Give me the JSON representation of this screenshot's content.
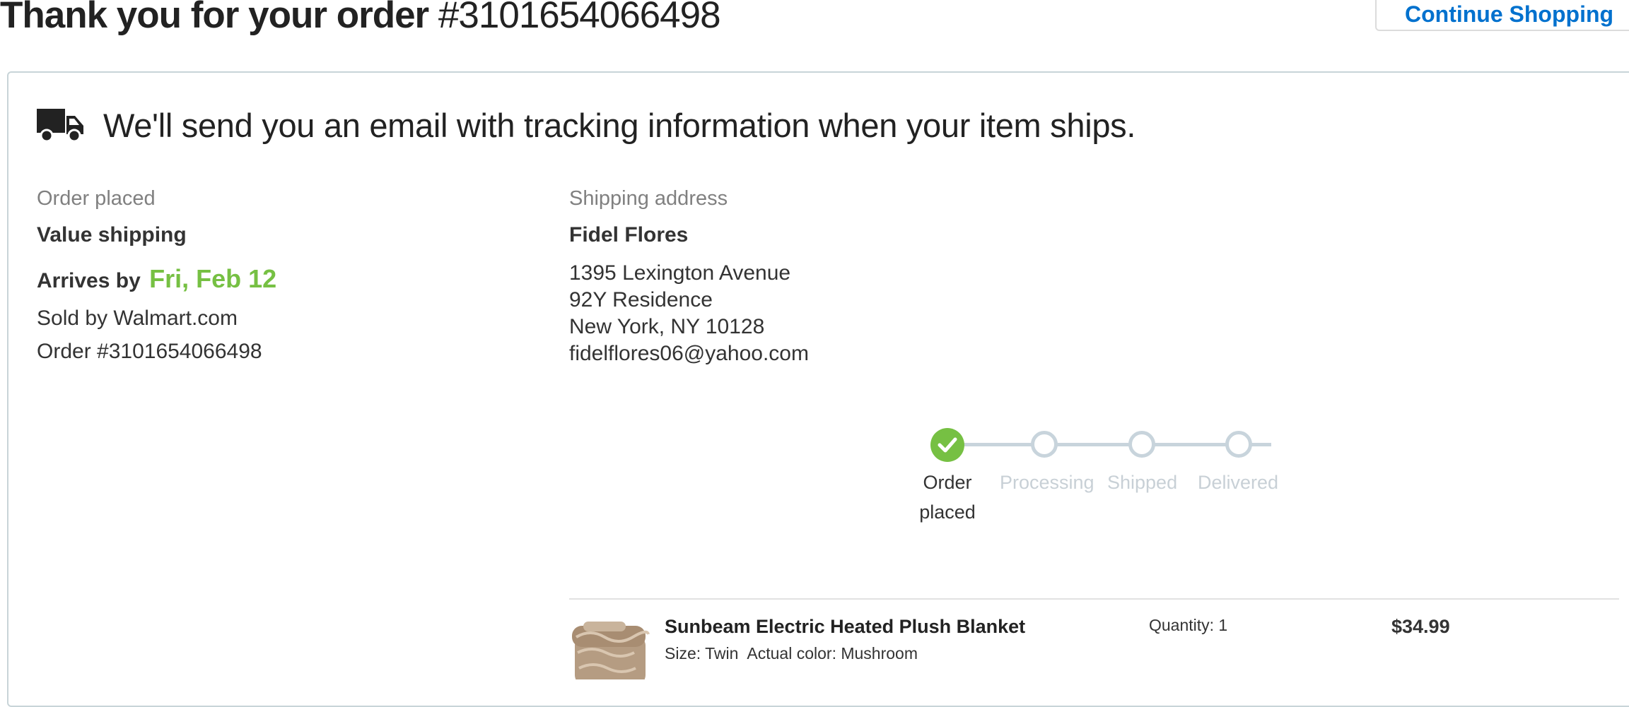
{
  "header": {
    "title_strong": "Thank you for your order",
    "order_number": "#3101654066498",
    "continue_label": "Continue Shopping"
  },
  "shipping_notice": {
    "icon": "truck-icon",
    "message": "We'll send you an email with tracking information when your item ships."
  },
  "order_info": {
    "status_label": "Order placed",
    "shipping_method": "Value shipping",
    "arrives_prefix": "Arrives by",
    "arrives_date": "Fri, Feb 12",
    "sold_by": "Sold by Walmart.com",
    "order_line": "Order #3101654066498"
  },
  "shipping_address": {
    "label": "Shipping address",
    "name": "Fidel Flores",
    "line1": "1395 Lexington Avenue",
    "line2": "92Y Residence",
    "line3": "New York, NY 10128",
    "email": "fidelflores06@yahoo.com"
  },
  "tracker": {
    "steps": [
      {
        "label": "Order placed",
        "state": "complete"
      },
      {
        "label": "Processing",
        "state": "pending"
      },
      {
        "label": "Shipped",
        "state": "pending"
      },
      {
        "label": "Delivered",
        "state": "pending"
      }
    ]
  },
  "item": {
    "name": "Sunbeam Electric Heated Plush Blanket",
    "size": "Size: Twin",
    "color": "Actual color: Mushroom",
    "quantity": "Quantity: 1",
    "price": "$34.99"
  },
  "colors": {
    "accent_blue": "#0071ce",
    "success_green": "#76c043",
    "inactive_gray": "#c8d4dc"
  }
}
